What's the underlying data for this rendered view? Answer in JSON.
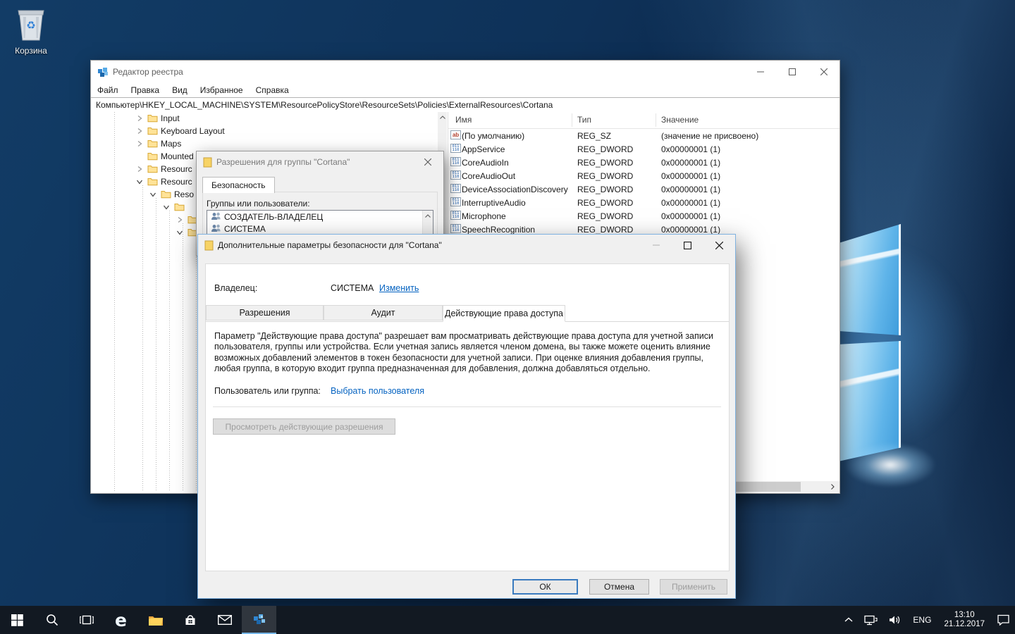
{
  "desktop": {
    "recycle_bin_label": "Корзина"
  },
  "regedit": {
    "title": "Редактор реестра",
    "menu": [
      "Файл",
      "Правка",
      "Вид",
      "Избранное",
      "Справка"
    ],
    "address": "Компьютер\\HKEY_LOCAL_MACHINE\\SYSTEM\\ResourcePolicyStore\\ResourceSets\\Policies\\ExternalResources\\Cortana",
    "tree": [
      {
        "label": "Input",
        "state": "collapsed",
        "level": 2
      },
      {
        "label": "Keyboard Layout",
        "state": "collapsed",
        "level": 2
      },
      {
        "label": "Maps",
        "state": "collapsed",
        "level": 2
      },
      {
        "label": "Mounted",
        "state": "leaf",
        "level": 2
      },
      {
        "label": "Resourc",
        "state": "collapsed",
        "level": 2
      },
      {
        "label": "Resourc",
        "state": "expanded",
        "level": 2
      },
      {
        "label": "Reso",
        "state": "expanded",
        "level": 3
      },
      {
        "label": "",
        "state": "expanded",
        "level": 4
      },
      {
        "label": "",
        "state": "collapsed",
        "level": 5
      },
      {
        "label": "",
        "state": "expanded",
        "level": 5
      }
    ],
    "columns": [
      "Имя",
      "Тип",
      "Значение"
    ],
    "values": [
      {
        "kind": "sz",
        "name": "(По умолчанию)",
        "type": "REG_SZ",
        "data": "(значение не присвоено)"
      },
      {
        "kind": "dword",
        "name": "AppService",
        "type": "REG_DWORD",
        "data": "0x00000001 (1)"
      },
      {
        "kind": "dword",
        "name": "CoreAudioIn",
        "type": "REG_DWORD",
        "data": "0x00000001 (1)"
      },
      {
        "kind": "dword",
        "name": "CoreAudioOut",
        "type": "REG_DWORD",
        "data": "0x00000001 (1)"
      },
      {
        "kind": "dword",
        "name": "DeviceAssociationDiscovery",
        "type": "REG_DWORD",
        "data": "0x00000001 (1)"
      },
      {
        "kind": "dword",
        "name": "InterruptiveAudio",
        "type": "REG_DWORD",
        "data": "0x00000001 (1)"
      },
      {
        "kind": "dword",
        "name": "Microphone",
        "type": "REG_DWORD",
        "data": "0x00000001 (1)"
      },
      {
        "kind": "dword",
        "name": "SpeechRecognition",
        "type": "REG_DWORD",
        "data": "0x00000001 (1)"
      }
    ]
  },
  "permissions_dialog": {
    "title": "Разрешения для группы \"Cortana\"",
    "security_tab": "Безопасность",
    "groups_label": "Группы или пользователи:",
    "groups": [
      "СОЗДАТЕЛЬ-ВЛАДЕЛЕЦ",
      "СИСТЕМА"
    ]
  },
  "advanced_dialog": {
    "title": "Дополнительные параметры безопасности  для \"Cortana\"",
    "owner_label": "Владелец:",
    "owner": "СИСТЕМА",
    "change_link": "Изменить",
    "tabs": [
      "Разрешения",
      "Аудит",
      "Действующие права доступа"
    ],
    "active_tab_index": 2,
    "description": "Параметр \"Действующие права доступа\" разрешает вам просматривать действующие права доступа для учетной записи пользователя, группы или устройства. Если учетная запись является членом домена, вы также можете оценить влияние возможных добавлений элементов в токен безопасности для учетной записи. При оценке влияния добавления группы, любая группа, в которую входит группа предназначенная для добавления, должна добавляться отдельно.",
    "user_group_label": "Пользователь или группа:",
    "select_user_link": "Выбрать пользователя",
    "view_permissions_button": "Просмотреть действующие разрешения",
    "ok_button": "ОК",
    "cancel_button": "Отмена",
    "apply_button": "Применить"
  },
  "taskbar": {
    "apps": [
      "start",
      "search",
      "task-view",
      "edge",
      "file-explorer",
      "store",
      "mail",
      "regedit"
    ],
    "active_app": "regedit",
    "tray": {
      "language": "ENG",
      "time": "13:10",
      "date": "21.12.2017"
    }
  },
  "colors": {
    "accent": "#0078d7",
    "link": "#0563c1",
    "taskbar": "#121922"
  }
}
